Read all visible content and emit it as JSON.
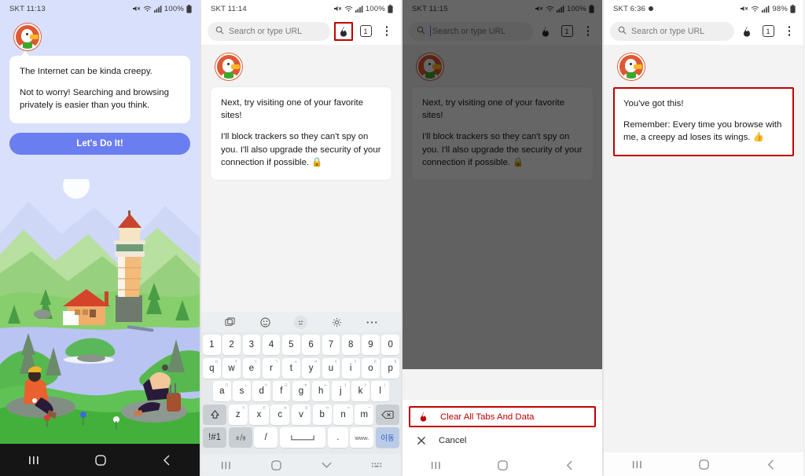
{
  "panels": [
    {
      "id": "onboarding-welcome",
      "status": {
        "carrier_time": "SKT 11:13",
        "battery": "100%",
        "recording": false
      },
      "message": {
        "line1": "The Internet can be kinda creepy.",
        "line2": "Not to worry! Searching and browsing privately is easier than you think."
      },
      "cta_label": "Let's Do It!",
      "illustration": "lighthouse-lake-campers",
      "navbar": [
        "recents-icon",
        "home-icon",
        "back-icon"
      ]
    },
    {
      "id": "onboarding-favorites-keyboard",
      "status": {
        "carrier_time": "SKT 11:14",
        "battery": "100%",
        "recording": false
      },
      "omnibox": {
        "placeholder": "Search or type URL",
        "value": "",
        "focused": false
      },
      "toolbar": {
        "fire_label": "fire-button",
        "tab_count": "1",
        "menu_label": "more-options"
      },
      "highlight": "fire-button",
      "message": {
        "line1": "Next, try visiting one of your favorite sites!",
        "line2": "I'll block trackers so they can't spy on you. I'll also upgrade the security of your connection if possible. 🔒"
      },
      "keyboard": {
        "toolbar_icons": [
          "clipboard-icon",
          "sticker-icon",
          "emoji-icon",
          "settings-icon",
          "more-icon"
        ],
        "row1": [
          "1",
          "2",
          "3",
          "4",
          "5",
          "6",
          "7",
          "8",
          "9",
          "0"
        ],
        "row2": [
          "q",
          "w",
          "e",
          "r",
          "t",
          "y",
          "u",
          "i",
          "o",
          "p"
        ],
        "row2_sup": [
          "ㅂ",
          "ㅈ",
          "ㄷ",
          "ㄱ",
          "ㅅ",
          "ㅛ",
          "ㅕ",
          "ㅑ",
          "ㅐ",
          "ㅔ"
        ],
        "row3": [
          "a",
          "s",
          "d",
          "f",
          "g",
          "h",
          "j",
          "k",
          "l"
        ],
        "row3_sup": [
          "ㅁ",
          "ㄴ",
          "ㅇ",
          "ㄹ",
          "ㅎ",
          "ㅗ",
          "ㅓ",
          "ㅏ",
          "ㅣ"
        ],
        "row4": [
          "z",
          "x",
          "c",
          "v",
          "b",
          "n",
          "m"
        ],
        "row4_sup": [
          "ㅋ",
          "ㅌ",
          "ㅊ",
          "ㅍ",
          "ㅠ",
          "ㅜ",
          "ㅡ"
        ],
        "shift_label": "shift-key",
        "backspace_label": "backspace-key",
        "symbols_label": "!#1",
        "lang_label": "ko-en-toggle",
        "slash_label": "/",
        "space_label": "space-key",
        "period_label": ".",
        "www_label": "www.",
        "go_label": "이동"
      },
      "navbar": [
        "recents-icon",
        "home-icon",
        "hide-keyboard-icon",
        "keyboard-switch-icon"
      ]
    },
    {
      "id": "fire-button-sheet",
      "status": {
        "carrier_time": "SKT 11:15",
        "battery": "100%",
        "recording": false
      },
      "omnibox": {
        "placeholder": "Search or type URL",
        "value": "",
        "focused": true
      },
      "toolbar": {
        "tab_count": "1"
      },
      "message": {
        "line1": "Next, try visiting one of your favorite sites!",
        "line2": "I'll block trackers so they can't spy on you. I'll also upgrade the security of your connection if possible. 🔒"
      },
      "sheet": {
        "primary_label": "Clear All Tabs And Data",
        "cancel_label": "Cancel",
        "highlight": "clear-all-tabs-and-data"
      },
      "navbar": [
        "recents-icon",
        "home-icon",
        "back-icon"
      ]
    },
    {
      "id": "onboarding-final",
      "status": {
        "carrier_time": "SKT 6:36",
        "battery": "98%",
        "recording": true
      },
      "omnibox": {
        "placeholder": "Search or type URL",
        "value": "",
        "focused": false
      },
      "toolbar": {
        "tab_count": "1"
      },
      "message": {
        "line1": "You've got this!",
        "line2": "Remember: Every time you browse with me, a creepy ad loses its wings. 👍"
      },
      "highlight": "message-bubble",
      "navbar": [
        "recents-icon",
        "home-icon",
        "back-icon"
      ]
    }
  ],
  "colors": {
    "onboarding_bg": "#d9e0fb",
    "cta": "#6b7ef0",
    "highlight_red": "#c00000",
    "ddg_orange": "#de5833",
    "browser_bg": "#f3f3f3"
  }
}
